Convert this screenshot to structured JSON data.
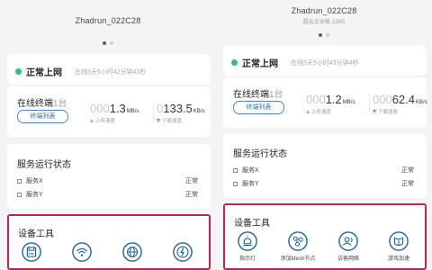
{
  "left": {
    "device_name": "Zhadrun_022C28",
    "device_sub": "",
    "status": {
      "label": "正常上网",
      "detail": "在线5天5小时42分钟41秒"
    },
    "terminal": {
      "title": "在线终端",
      "count": "1台",
      "button": "终端列表"
    },
    "upload": {
      "faint": "000",
      "value": "1.3",
      "unit": "MB/s",
      "label": "上传速度"
    },
    "download": {
      "faint": "0",
      "value": "133.5",
      "unit": "KB/s",
      "label": "下载速度"
    },
    "services": {
      "title": "服务运行状态",
      "items": [
        {
          "name": "服务X",
          "status": "正常"
        },
        {
          "name": "服务Y",
          "status": "正常"
        }
      ]
    },
    "tools": {
      "title": "设备工具",
      "items": [
        {
          "label": "",
          "icon": "save-icon"
        },
        {
          "label": "",
          "icon": "wifi-icon"
        },
        {
          "label": "",
          "icon": "globe-icon"
        },
        {
          "label": "",
          "icon": "speed-test-icon"
        }
      ]
    }
  },
  "right": {
    "device_name": "Zhadrun_022C28",
    "device_sub": "超云企业版 128G",
    "status": {
      "label": "正常上网",
      "detail": "在线5天5小时43分钟4秒"
    },
    "terminal": {
      "title": "在线终端",
      "count": "1台",
      "button": "终端列表"
    },
    "upload": {
      "faint": "000",
      "value": "1.2",
      "unit": "MB/s",
      "label": "上传速度"
    },
    "download": {
      "faint": "000",
      "value": "62.4",
      "unit": "KB/s",
      "label": "下载速度"
    },
    "services": {
      "title": "服务运行状态",
      "items": [
        {
          "name": "服务X",
          "status": "正常"
        },
        {
          "name": "服务Y",
          "status": "正常"
        }
      ]
    },
    "tools": {
      "title": "设备工具",
      "items": [
        {
          "label": "指示灯",
          "icon": "indicator-light-icon"
        },
        {
          "label": "添加Mesh节点",
          "icon": "mesh-node-icon"
        },
        {
          "label": "访客网络",
          "icon": "guest-network-icon"
        },
        {
          "label": "游戏加速",
          "icon": "game-boost-icon"
        }
      ]
    }
  },
  "colors": {
    "background": "#f3f4f6",
    "accent": "#2f6fb5",
    "online": "#2ec46b",
    "upload_arrow": "#f0a23a",
    "highlight_border": "#c0244e"
  }
}
